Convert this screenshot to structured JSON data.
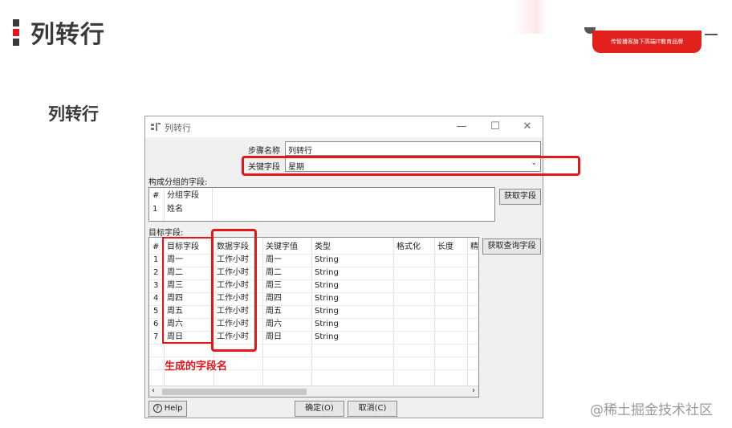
{
  "slide": {
    "title": "列转行",
    "section_title": "列转行",
    "brand_text": "传智播客旗下高端IT教育品牌",
    "watermark": "@稀土掘金技术社区",
    "colors": {
      "accent": "#e3161a",
      "bar_dark": "#3a3a3a"
    }
  },
  "dialog": {
    "title": "列转行",
    "icon": "transform-step-icon",
    "window_controls": {
      "minimize": "—",
      "maximize": "☐",
      "close": "✕"
    },
    "step_name_label": "步骤名称",
    "step_name_value": "列转行",
    "key_field_label": "关键字段",
    "key_field_value": "星期",
    "group_fields_label": "构成分组的字段:",
    "group_table": {
      "headers": [
        "#",
        "分组字段"
      ],
      "rows": [
        [
          "1",
          "姓名"
        ]
      ]
    },
    "get_fields_button": "获取字段",
    "target_fields_label": "目标字段:",
    "target_table": {
      "headers": [
        "#",
        "目标字段",
        "数据字段",
        "关键字值",
        "类型",
        "格式化",
        "长度",
        "精"
      ],
      "rows": [
        [
          "1",
          "周一",
          "工作小时",
          "周一",
          "String"
        ],
        [
          "2",
          "周二",
          "工作小时",
          "周二",
          "String"
        ],
        [
          "3",
          "周三",
          "工作小时",
          "周三",
          "String"
        ],
        [
          "4",
          "周四",
          "工作小时",
          "周四",
          "String"
        ],
        [
          "5",
          "周五",
          "工作小时",
          "周五",
          "String"
        ],
        [
          "6",
          "周六",
          "工作小时",
          "周六",
          "String"
        ],
        [
          "7",
          "周日",
          "工作小时",
          "周日",
          "String"
        ]
      ]
    },
    "get_lookup_fields_button": "获取查询字段",
    "annotation_note": "生成的字段名",
    "help_button": "Help",
    "ok_button": "确定(O)",
    "cancel_button": "取消(C)"
  }
}
